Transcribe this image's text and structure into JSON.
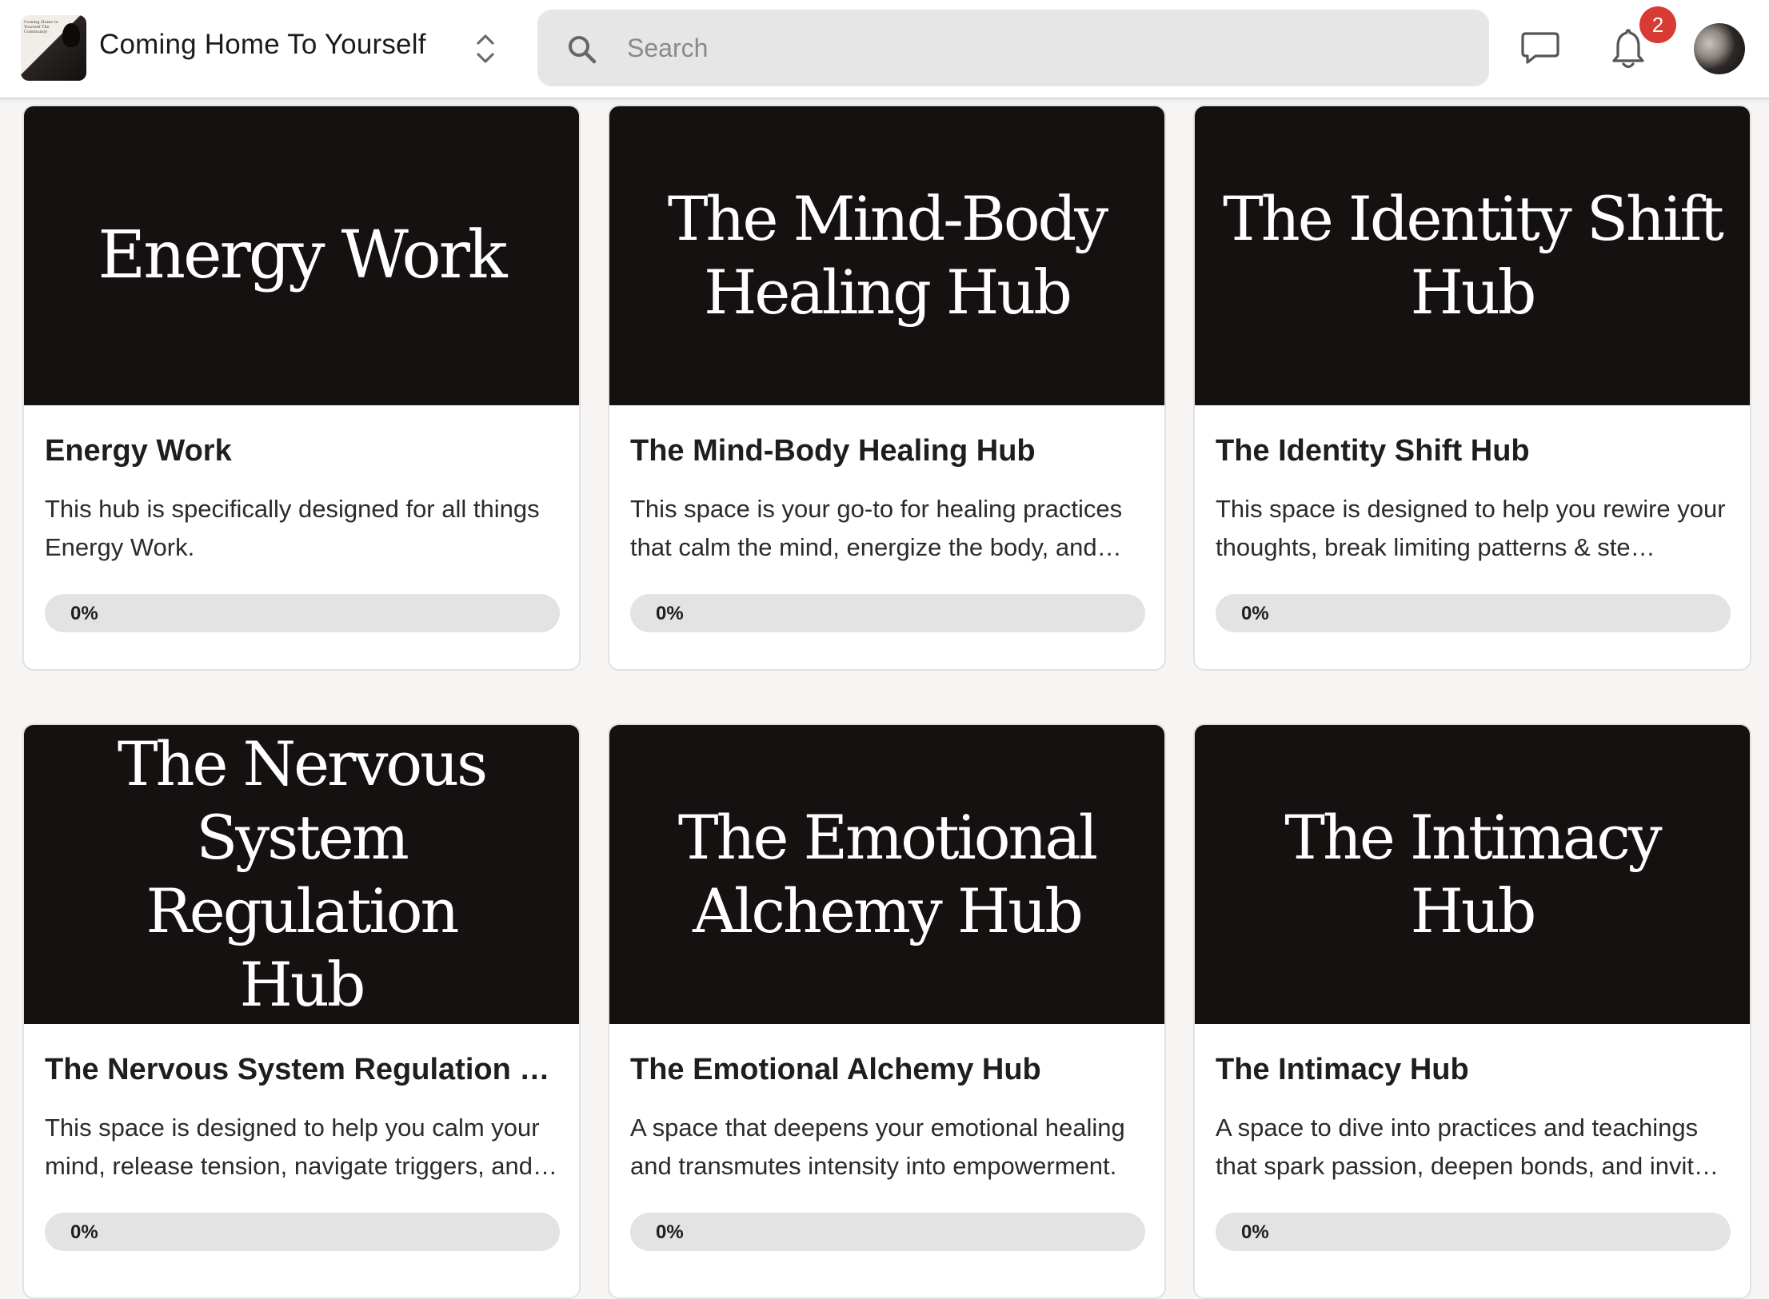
{
  "header": {
    "community_name": "Coming Home To Yourself",
    "logo_text": "Coming Home to Yourself The Community",
    "search_placeholder": "Search",
    "notification_count": "2",
    "icons": {
      "switcher": "chevron-up-down-icon",
      "search": "search-icon",
      "chat": "chat-icon",
      "bell": "bell-icon"
    },
    "colors": {
      "badge": "#d73b33",
      "search_bg": "#e6e6e6"
    }
  },
  "cards": [
    {
      "cover_lines": [
        "Energy Work"
      ],
      "title": "Energy Work",
      "description": "This hub is specifically designed for all things Energy Work.",
      "progress_label": "0%",
      "progress": 0
    },
    {
      "cover_lines": [
        "The Mind-Body",
        "Healing Hub"
      ],
      "title": "The Mind-Body Healing Hub",
      "description": "This space is your go-to for healing practices that calm the mind, energize the body, and…",
      "progress_label": "0%",
      "progress": 0
    },
    {
      "cover_lines": [
        "The Identity Shift",
        "Hub"
      ],
      "title": "The Identity Shift Hub",
      "description": "This space is designed to help you rewire your thoughts, break limiting patterns & ste…",
      "progress_label": "0%",
      "progress": 0
    },
    {
      "cover_lines": [
        "The Nervous",
        "System Regulation",
        "Hub"
      ],
      "title": "The Nervous System Regulation …",
      "description": "This space is designed to help you calm your mind, release tension, navigate triggers, and…",
      "progress_label": "0%",
      "progress": 0
    },
    {
      "cover_lines": [
        "The Emotional",
        "Alchemy Hub"
      ],
      "title": "The Emotional Alchemy Hub",
      "description": "A space that deepens your emotional healing and transmutes intensity into empowerment.",
      "progress_label": "0%",
      "progress": 0
    },
    {
      "cover_lines": [
        "The Intimacy Hub"
      ],
      "title": "The Intimacy Hub",
      "description": "A space to dive into practices and teachings that spark passion, deepen bonds, and invit…",
      "progress_label": "0%",
      "progress": 0
    }
  ]
}
